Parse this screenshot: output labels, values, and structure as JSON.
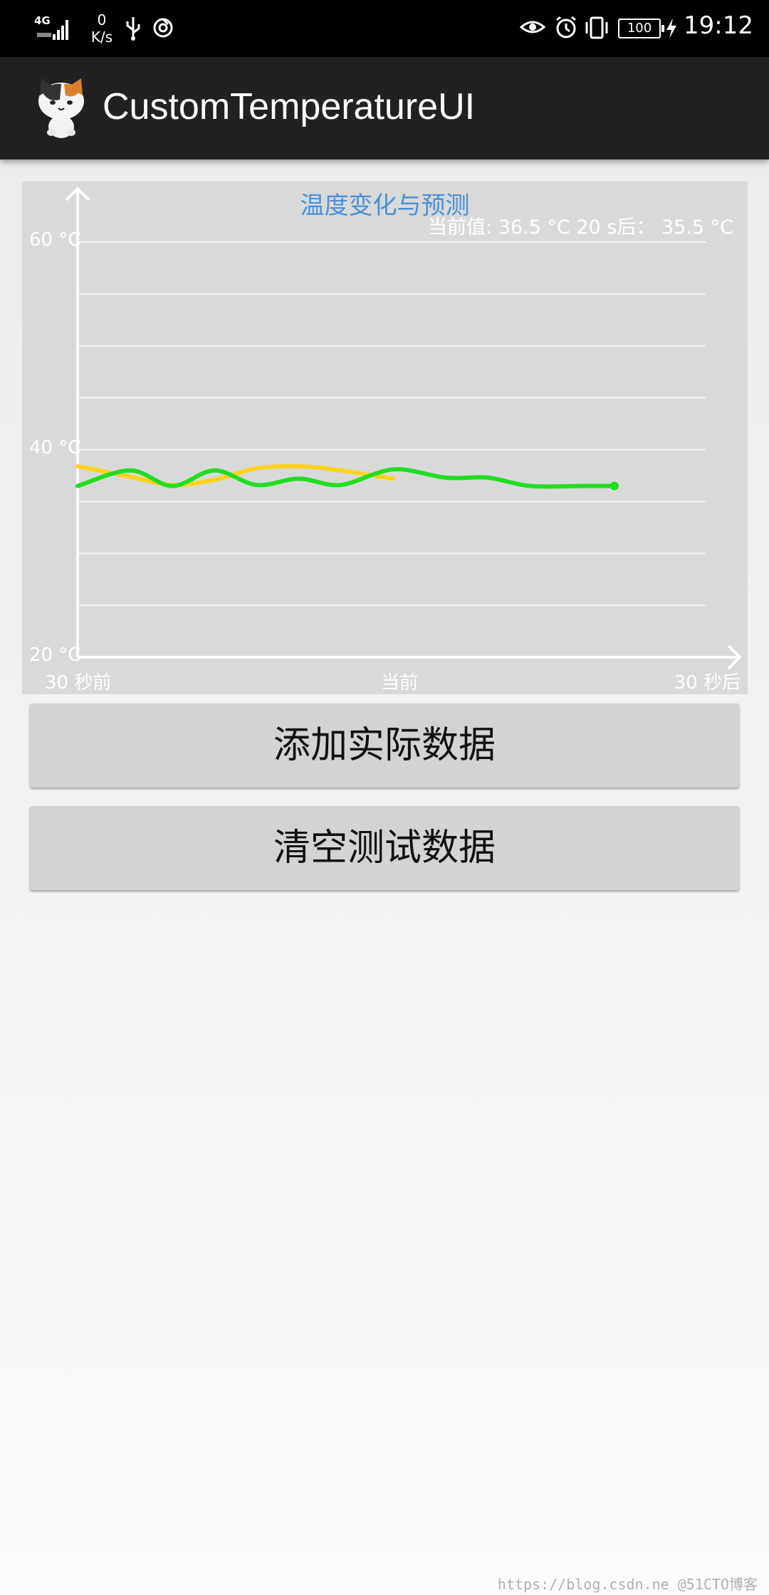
{
  "status_bar": {
    "network_type": "4G",
    "net_speed_value": "0",
    "net_speed_unit": "K/s",
    "battery": "100",
    "time": "19:12"
  },
  "app": {
    "title": "CustomTemperatureUI"
  },
  "chart": {
    "title": "温度变化与预测",
    "readout": "当前值: 36.5 °C 20 s后： 35.5 °C"
  },
  "chart_data": {
    "type": "line",
    "title": "温度变化与预测",
    "xlabel": "",
    "ylabel": "",
    "x_tick_labels": [
      "30 秒前",
      "当前",
      "30 秒后"
    ],
    "y_tick_labels": [
      "60 °C",
      "40 °C",
      "20 °C"
    ],
    "xlim": [
      -30,
      30
    ],
    "ylim": [
      20,
      60
    ],
    "grid": true,
    "series": [
      {
        "color": "#22dd22",
        "x": [
          -30,
          -25,
          -21,
          -17,
          -13,
          -9,
          -5,
          0,
          5,
          9,
          13,
          18,
          21
        ],
        "y": [
          36.5,
          38.0,
          36.5,
          38.0,
          36.6,
          37.2,
          36.6,
          38.1,
          37.3,
          37.3,
          36.5,
          36.5,
          36.5
        ],
        "marker_last": true
      },
      {
        "color": "#ffd21e",
        "x": [
          -30,
          -25,
          -21,
          -17,
          -13,
          -9,
          -5,
          0
        ],
        "y": [
          38.4,
          37.4,
          36.6,
          37.1,
          38.2,
          38.4,
          38.0,
          37.2
        ]
      }
    ]
  },
  "buttons": {
    "add_label": "添加实际数据",
    "clear_label": "清空测试数据"
  },
  "watermark": "https://blog.csdn.ne @51CTO博客"
}
